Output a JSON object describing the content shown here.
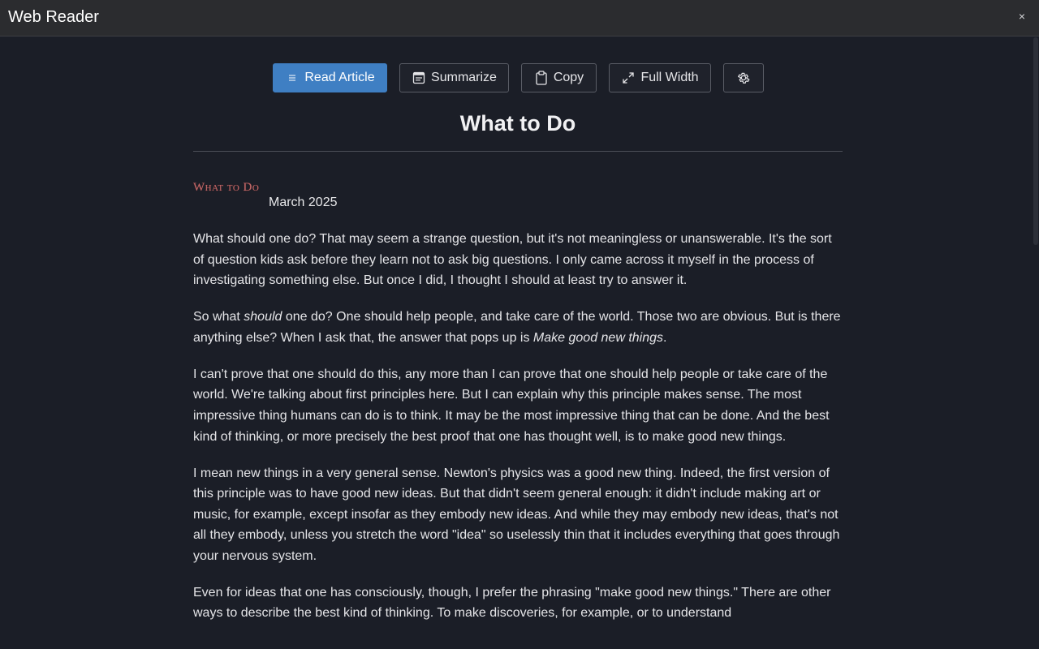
{
  "window": {
    "title": "Web Reader",
    "close_glyph": "×"
  },
  "toolbar": {
    "read_label": "Read Article",
    "read_icon": "list-icon",
    "summarize_label": "Summarize",
    "summarize_icon": "document-icon",
    "copy_label": "Copy",
    "copy_icon": "clipboard-icon",
    "fullwidth_label": "Full Width",
    "fullwidth_icon": "expand-icon",
    "settings_icon": "gear-icon"
  },
  "article": {
    "title": "What to Do",
    "logo_text": "What to Do",
    "date": "March 2025",
    "paragraphs": [
      [
        {
          "t": "What should one do? That may seem a strange question, but it's not meaningless or unanswerable. It's the sort of question kids ask before they learn not to ask big questions. I only came across it myself in the process of investigating something else. But once I did, I thought I should at least try to answer it."
        }
      ],
      [
        {
          "t": "So what "
        },
        {
          "t": "should",
          "em": true
        },
        {
          "t": " one do? One should help people, and take care of the world. Those two are obvious. But is there anything else? When I ask that, the answer that pops up is "
        },
        {
          "t": "Make good new things",
          "em": true
        },
        {
          "t": "."
        }
      ],
      [
        {
          "t": "I can't prove that one should do this, any more than I can prove that one should help people or take care of the world. We're talking about first principles here. But I can explain why this principle makes sense. The most impressive thing humans can do is to think. It may be the most impressive thing that can be done. And the best kind of thinking, or more precisely the best proof that one has thought well, is to make good new things."
        }
      ],
      [
        {
          "t": "I mean new things in a very general sense. Newton's physics was a good new thing. Indeed, the first version of this principle was to have good new ideas. But that didn't seem general enough: it didn't include making art or music, for example, except insofar as they embody new ideas. And while they may embody new ideas, that's not all they embody, unless you stretch the word \"idea\" so uselessly thin that it includes everything that goes through your nervous system."
        }
      ],
      [
        {
          "t": "Even for ideas that one has consciously, though, I prefer the phrasing \"make good new things.\" There are other ways to describe the best kind of thinking. To make discoveries, for example, or to understand"
        }
      ]
    ]
  },
  "colors": {
    "background": "#1b1e27",
    "titlebar": "#2b2c2f",
    "primary_button": "#3f7fc3",
    "logo": "#c26a6a"
  }
}
